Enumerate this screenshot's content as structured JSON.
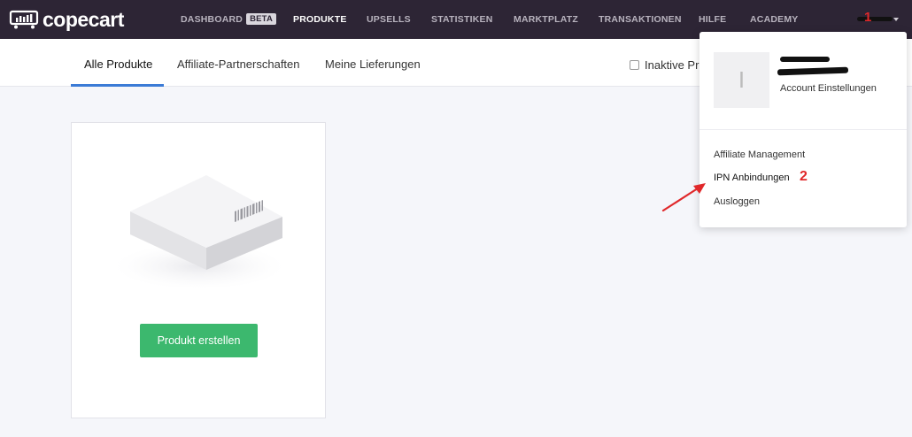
{
  "app": {
    "logo_text": "copecart"
  },
  "topnav": {
    "items": [
      {
        "label": "DASHBOARD",
        "badge": "BETA"
      },
      {
        "label": "PRODUKTE"
      },
      {
        "label": "UPSELLS"
      },
      {
        "label": "STATISTIKEN"
      },
      {
        "label": "MARKTPLATZ"
      },
      {
        "label": "TRANSAKTIONEN"
      },
      {
        "label": "HILFE"
      },
      {
        "label": "ACADEMY"
      }
    ],
    "active": "PRODUKTE"
  },
  "subnav": {
    "tabs": [
      {
        "label": "Alle Produkte"
      },
      {
        "label": "Affiliate-Partnerschaften"
      },
      {
        "label": "Meine Lieferungen"
      }
    ],
    "active": "Alle Produkte",
    "inactive_filter_label": "Inaktive Pro"
  },
  "card": {
    "create_button_label": "Produkt erstellen"
  },
  "dropdown": {
    "avatar_initial": "I",
    "account_settings_label": "Account Einstellungen",
    "items": [
      {
        "label": "Affiliate Management"
      },
      {
        "label": "IPN Anbindungen"
      },
      {
        "label": "Ausloggen"
      }
    ]
  },
  "annotations": {
    "marker_1": "1",
    "marker_2": "2",
    "color": "#e0282a"
  },
  "colors": {
    "topbar": "#2d2535",
    "accent_tab": "#3b7bd6",
    "button_green": "#3cb86e"
  }
}
